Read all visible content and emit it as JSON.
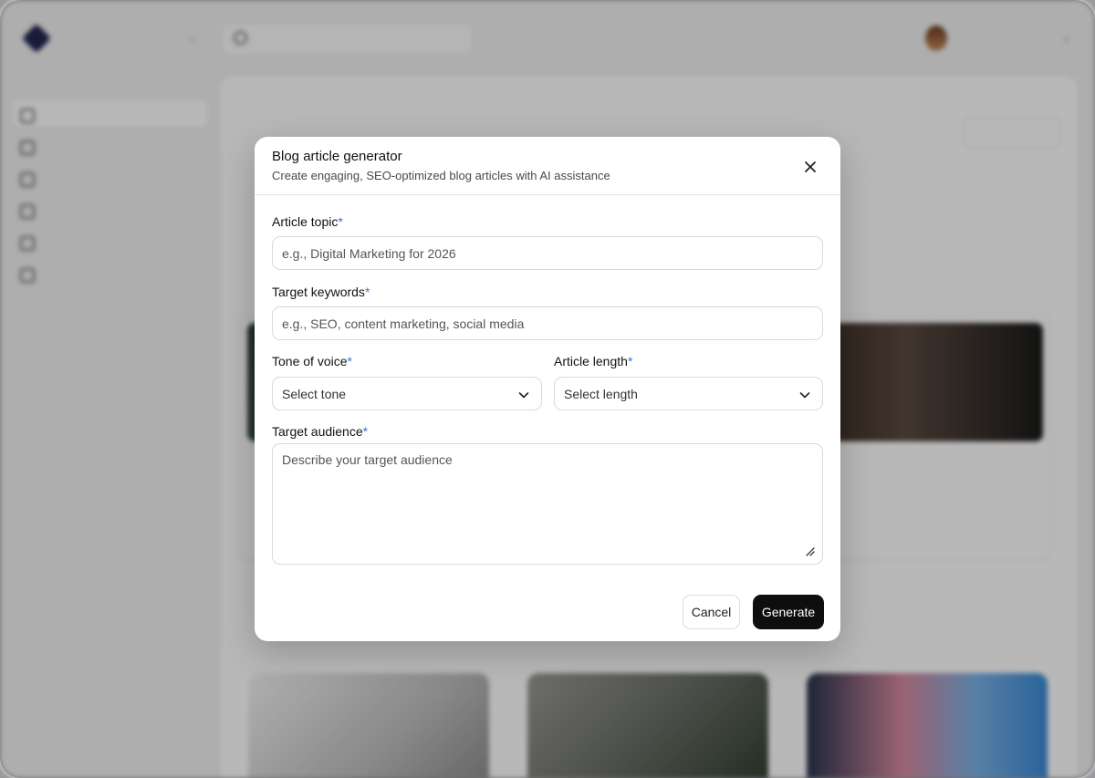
{
  "modal": {
    "title": "Blog article generator",
    "subtitle": "Create engaging, SEO-optimized blog articles with AI assistance",
    "close_icon": "close-icon",
    "required_marker": "*",
    "fields": {
      "topic": {
        "label": "Article topic",
        "value": "",
        "placeholder": "e.g., Digital Marketing for 2026"
      },
      "keywords": {
        "label": "Target keywords",
        "value": "",
        "placeholder": "e.g., SEO, content marketing, social media"
      },
      "tone": {
        "label": "Tone of voice",
        "selected": "Select tone"
      },
      "length": {
        "label": "Article length",
        "selected": "Select length"
      },
      "audience": {
        "label": "Target audience",
        "value": "",
        "placeholder": "Describe your target audience"
      }
    },
    "cancel_label": "Cancel",
    "generate_label": "Generate",
    "accent_color": "#3b6fe0",
    "primary_button_color": "#0e0e10"
  }
}
